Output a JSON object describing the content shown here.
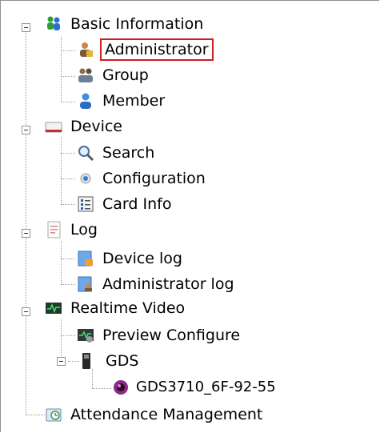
{
  "tree": {
    "basic_information": {
      "label": "Basic Information",
      "icon": "people-icon",
      "children": {
        "administrator": {
          "label": "Administrator",
          "icon": "admin-user-icon"
        },
        "group": {
          "label": "Group",
          "icon": "group-users-icon"
        },
        "member": {
          "label": "Member",
          "icon": "member-user-icon"
        }
      }
    },
    "device": {
      "label": "Device",
      "icon": "device-icon",
      "children": {
        "search": {
          "label": "Search",
          "icon": "magnifier-icon"
        },
        "configuration": {
          "label": "Configuration",
          "icon": "gear-icon"
        },
        "card_info": {
          "label": "Card Info",
          "icon": "card-list-icon"
        }
      }
    },
    "log": {
      "label": "Log",
      "icon": "log-document-icon",
      "children": {
        "device_log": {
          "label": "Device log",
          "icon": "device-log-icon"
        },
        "administrator_log": {
          "label": "Administrator log",
          "icon": "admin-log-icon"
        }
      }
    },
    "realtime_video": {
      "label": "Realtime Video",
      "icon": "video-monitor-icon",
      "children": {
        "preview_configure": {
          "label": "Preview Configure",
          "icon": "preview-config-icon"
        },
        "gds": {
          "label": "GDS",
          "icon": "gds-device-icon",
          "children": {
            "gds3710": {
              "label": "GDS3710_6F-92-55",
              "icon": "camera-lens-icon"
            }
          }
        }
      }
    },
    "attendance_management": {
      "label": "Attendance Management",
      "icon": "clock-calendar-icon"
    }
  },
  "selected_item": "Administrator",
  "colors": {
    "selection_border": "#cc1f1f",
    "guide_lines": "#a0a0a0"
  }
}
